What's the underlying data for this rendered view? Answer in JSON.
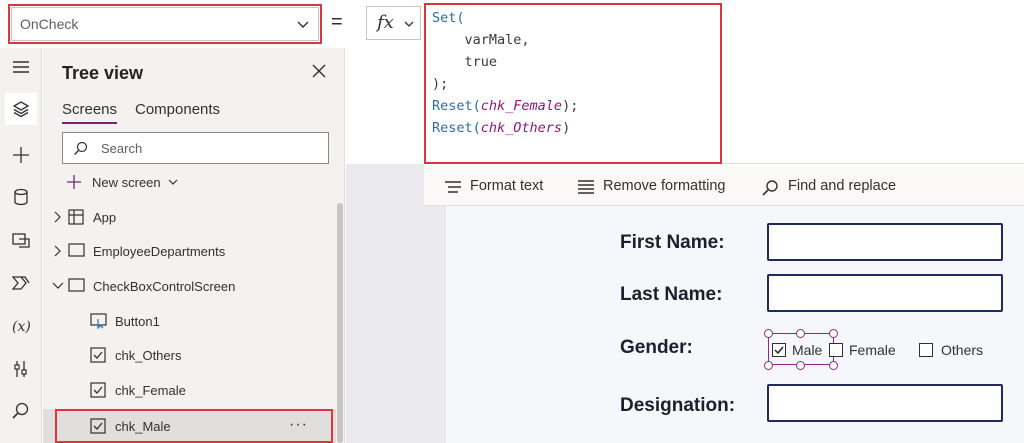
{
  "formula_bar": {
    "property": "OnCheck",
    "equals": "=",
    "fx": "fx",
    "code_lines": [
      {
        "fn": "Set(",
        "rest": ""
      },
      {
        "indent": "    ",
        "plain": "varMale,"
      },
      {
        "indent": "    ",
        "plain": "true"
      },
      {
        "plain": ");"
      },
      {
        "fn": "Reset(",
        "id": "chk_Female",
        "close": ");"
      },
      {
        "fn": "Reset(",
        "id": "chk_Others",
        "close": ")"
      }
    ]
  },
  "format_bar": {
    "format_text": "Format text",
    "remove_formatting": "Remove formatting",
    "find_replace": "Find and replace"
  },
  "tree_view": {
    "title": "Tree view",
    "tabs": [
      "Screens",
      "Components"
    ],
    "search_placeholder": "Search",
    "new_screen": "New screen",
    "nodes": [
      {
        "label": "App"
      },
      {
        "label": "EmployeeDepartments"
      },
      {
        "label": "CheckBoxControlScreen"
      },
      {
        "label": "Button1"
      },
      {
        "label": "chk_Others"
      },
      {
        "label": "chk_Female"
      },
      {
        "label": "chk_Male"
      }
    ],
    "more": "···"
  },
  "form": {
    "first_name": "First Name:",
    "last_name": "Last Name:",
    "gender": "Gender:",
    "designation": "Designation:",
    "options": [
      {
        "label": "Male",
        "checked": true
      },
      {
        "label": "Female",
        "checked": false
      },
      {
        "label": "Others",
        "checked": false
      }
    ]
  },
  "colors": {
    "highlight": "#d9363e",
    "accent": "#742774",
    "input_border": "#1f2b5c"
  },
  "icons": [
    "chevron-down-icon",
    "hamburger-icon",
    "layers-icon",
    "plus-icon",
    "database-icon",
    "media-icon",
    "power-automate-icon",
    "variables-icon",
    "tools-icon",
    "search-icon",
    "close-icon"
  ]
}
